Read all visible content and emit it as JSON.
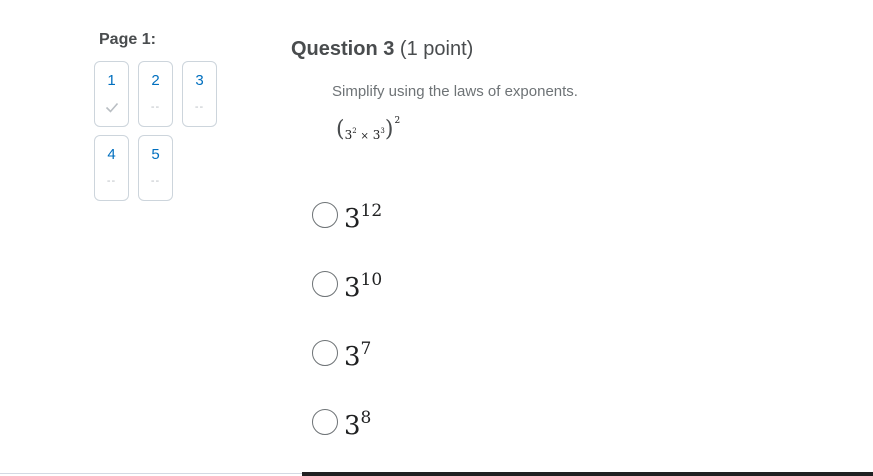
{
  "page": {
    "label": "Page 1:"
  },
  "question_nav": [
    {
      "number": "1",
      "status": "✓"
    },
    {
      "number": "2",
      "status": "--"
    },
    {
      "number": "3",
      "status": "--"
    },
    {
      "number": "4",
      "status": "--"
    },
    {
      "number": "5",
      "status": "--"
    }
  ],
  "question": {
    "number_label": "Question 3",
    "points_label": "(1 point)",
    "prompt": "Simplify using the laws of exponents.",
    "expression": {
      "open_paren": "(",
      "close_paren": ")",
      "base1": "3",
      "exp1": "2",
      "times": "×",
      "base2": "3",
      "exp2": "3",
      "outer_exp": "2"
    }
  },
  "options": [
    {
      "base": "3",
      "exponent": "12"
    },
    {
      "base": "3",
      "exponent": "10"
    },
    {
      "base": "3",
      "exponent": "7"
    },
    {
      "base": "3",
      "exponent": "8"
    }
  ],
  "colors": {
    "link_blue": "#006fbf",
    "tile_border": "#cdd5dc",
    "text_dark": "#494c4e",
    "text_muted": "#6e7376"
  }
}
